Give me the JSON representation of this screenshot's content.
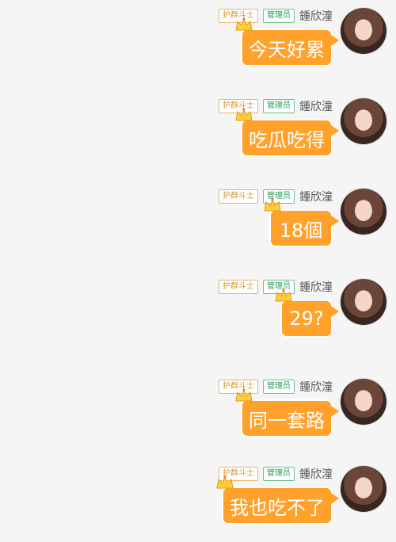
{
  "messages": [
    {
      "guard_badge": "护群斗士",
      "admin_badge": "管理员",
      "nickname": "鍾欣潼",
      "text": "今天好累"
    },
    {
      "guard_badge": "护群斗士",
      "admin_badge": "管理员",
      "nickname": "鍾欣潼",
      "text": "吃瓜吃得"
    },
    {
      "guard_badge": "护群斗士",
      "admin_badge": "管理员",
      "nickname": "鍾欣潼",
      "text": "18個"
    },
    {
      "guard_badge": "护群斗士",
      "admin_badge": "管理员",
      "nickname": "鍾欣潼",
      "text": "29?"
    },
    {
      "guard_badge": "护群斗士",
      "admin_badge": "管理员",
      "nickname": "鍾欣潼",
      "text": "同一套路"
    },
    {
      "guard_badge": "护群斗士",
      "admin_badge": "管理员",
      "nickname": "鍾欣潼",
      "text": "我也吃不了"
    }
  ],
  "colors": {
    "bubble": "#ffa12b",
    "background": "#f5f5f5",
    "guard_badge": "#d09a3a",
    "admin_badge": "#2a9b5a"
  },
  "icons": {
    "crown": "crown-icon"
  }
}
